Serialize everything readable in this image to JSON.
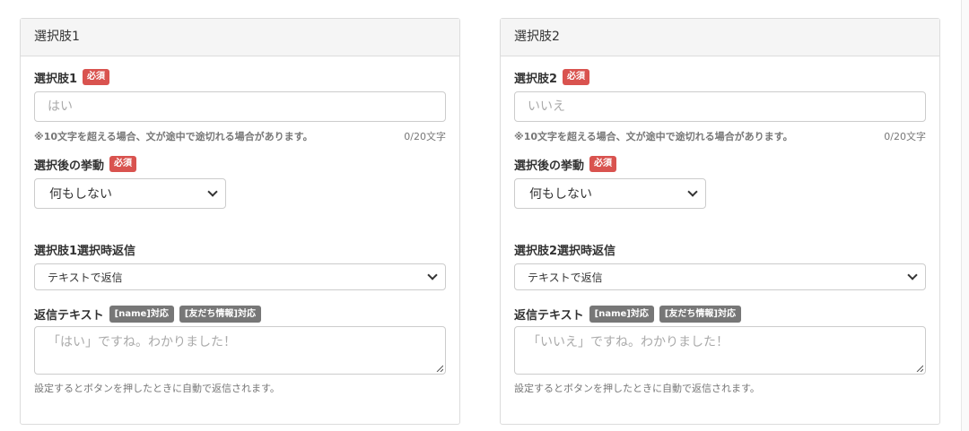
{
  "panels": [
    {
      "header": "選択肢1",
      "choice_label": "選択肢1",
      "required": "必須",
      "choice_placeholder": "はい",
      "note": "※10文字を超える場合、文が途中で途切れる場合があります。",
      "counter": "0/20文字",
      "behavior_label": "選択後の挙動",
      "behavior_value": "何もしない",
      "reply_label": "選択肢1選択時返信",
      "reply_value": "テキストで返信",
      "reply_text_label": "返信テキスト",
      "tag_name": "[name]対応",
      "tag_friend": "[友だち情報]対応",
      "reply_text_placeholder": "「はい」ですね。わかりました！",
      "help": "設定するとボタンを押したときに自動で返信されます。"
    },
    {
      "header": "選択肢2",
      "choice_label": "選択肢2",
      "required": "必須",
      "choice_placeholder": "いいえ",
      "note": "※10文字を超える場合、文が途中で途切れる場合があります。",
      "counter": "0/20文字",
      "behavior_label": "選択後の挙動",
      "behavior_value": "何もしない",
      "reply_label": "選択肢2選択時返信",
      "reply_value": "テキストで返信",
      "reply_text_label": "返信テキスト",
      "tag_name": "[name]対応",
      "tag_friend": "[友だち情報]対応",
      "reply_text_placeholder": "「いいえ」ですね。わかりました！",
      "help": "設定するとボタンを押したときに自動で返信されます。"
    }
  ],
  "colors": {
    "required_badge": "#d9534f",
    "tag_badge": "#777777",
    "header_bg": "#f5f5f5"
  }
}
